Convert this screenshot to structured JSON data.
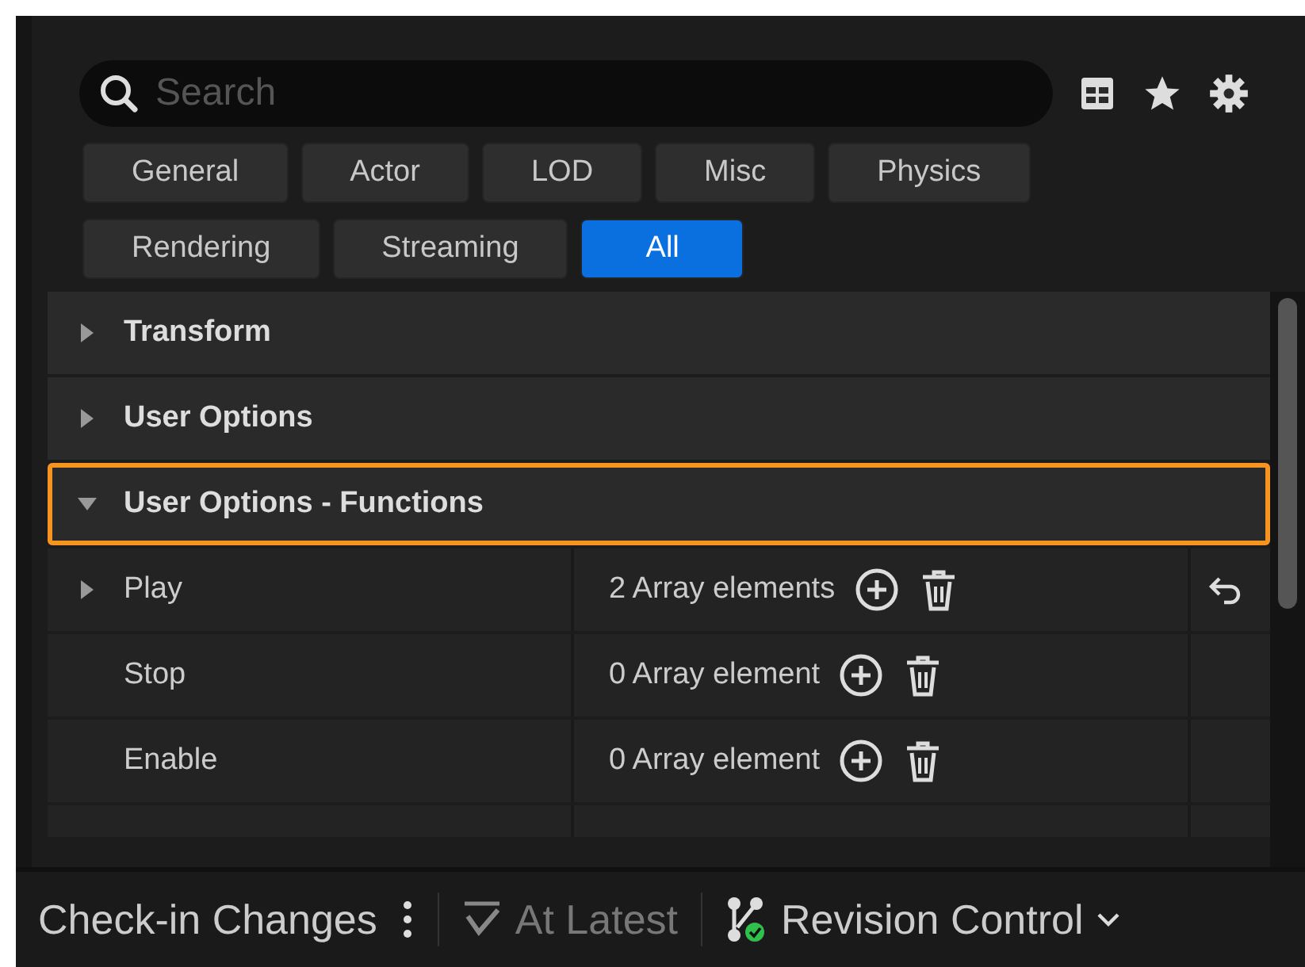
{
  "search": {
    "placeholder": "Search"
  },
  "filters": [
    {
      "label": "General",
      "selected": false
    },
    {
      "label": "Actor",
      "selected": false
    },
    {
      "label": "LOD",
      "selected": false
    },
    {
      "label": "Misc",
      "selected": false
    },
    {
      "label": "Physics",
      "selected": false
    },
    {
      "label": "Rendering",
      "selected": false
    },
    {
      "label": "Streaming",
      "selected": false
    },
    {
      "label": "All",
      "selected": true
    }
  ],
  "categories": [
    {
      "label": "Transform",
      "expanded": false,
      "highlighted": false
    },
    {
      "label": "User Options",
      "expanded": false,
      "highlighted": false
    },
    {
      "label": "User Options - Functions",
      "expanded": true,
      "highlighted": true
    }
  ],
  "properties": [
    {
      "name": "Play",
      "expandable": true,
      "value": "2 Array elements",
      "resettable": true
    },
    {
      "name": "Stop",
      "expandable": false,
      "value": "0 Array element",
      "resettable": false
    },
    {
      "name": "Enable",
      "expandable": false,
      "value": "0 Array element",
      "resettable": false
    }
  ],
  "status_bar": {
    "checkin": "Check-in Changes",
    "sync": {
      "label": "At Latest",
      "disabled": true
    },
    "revision": "Revision Control"
  }
}
